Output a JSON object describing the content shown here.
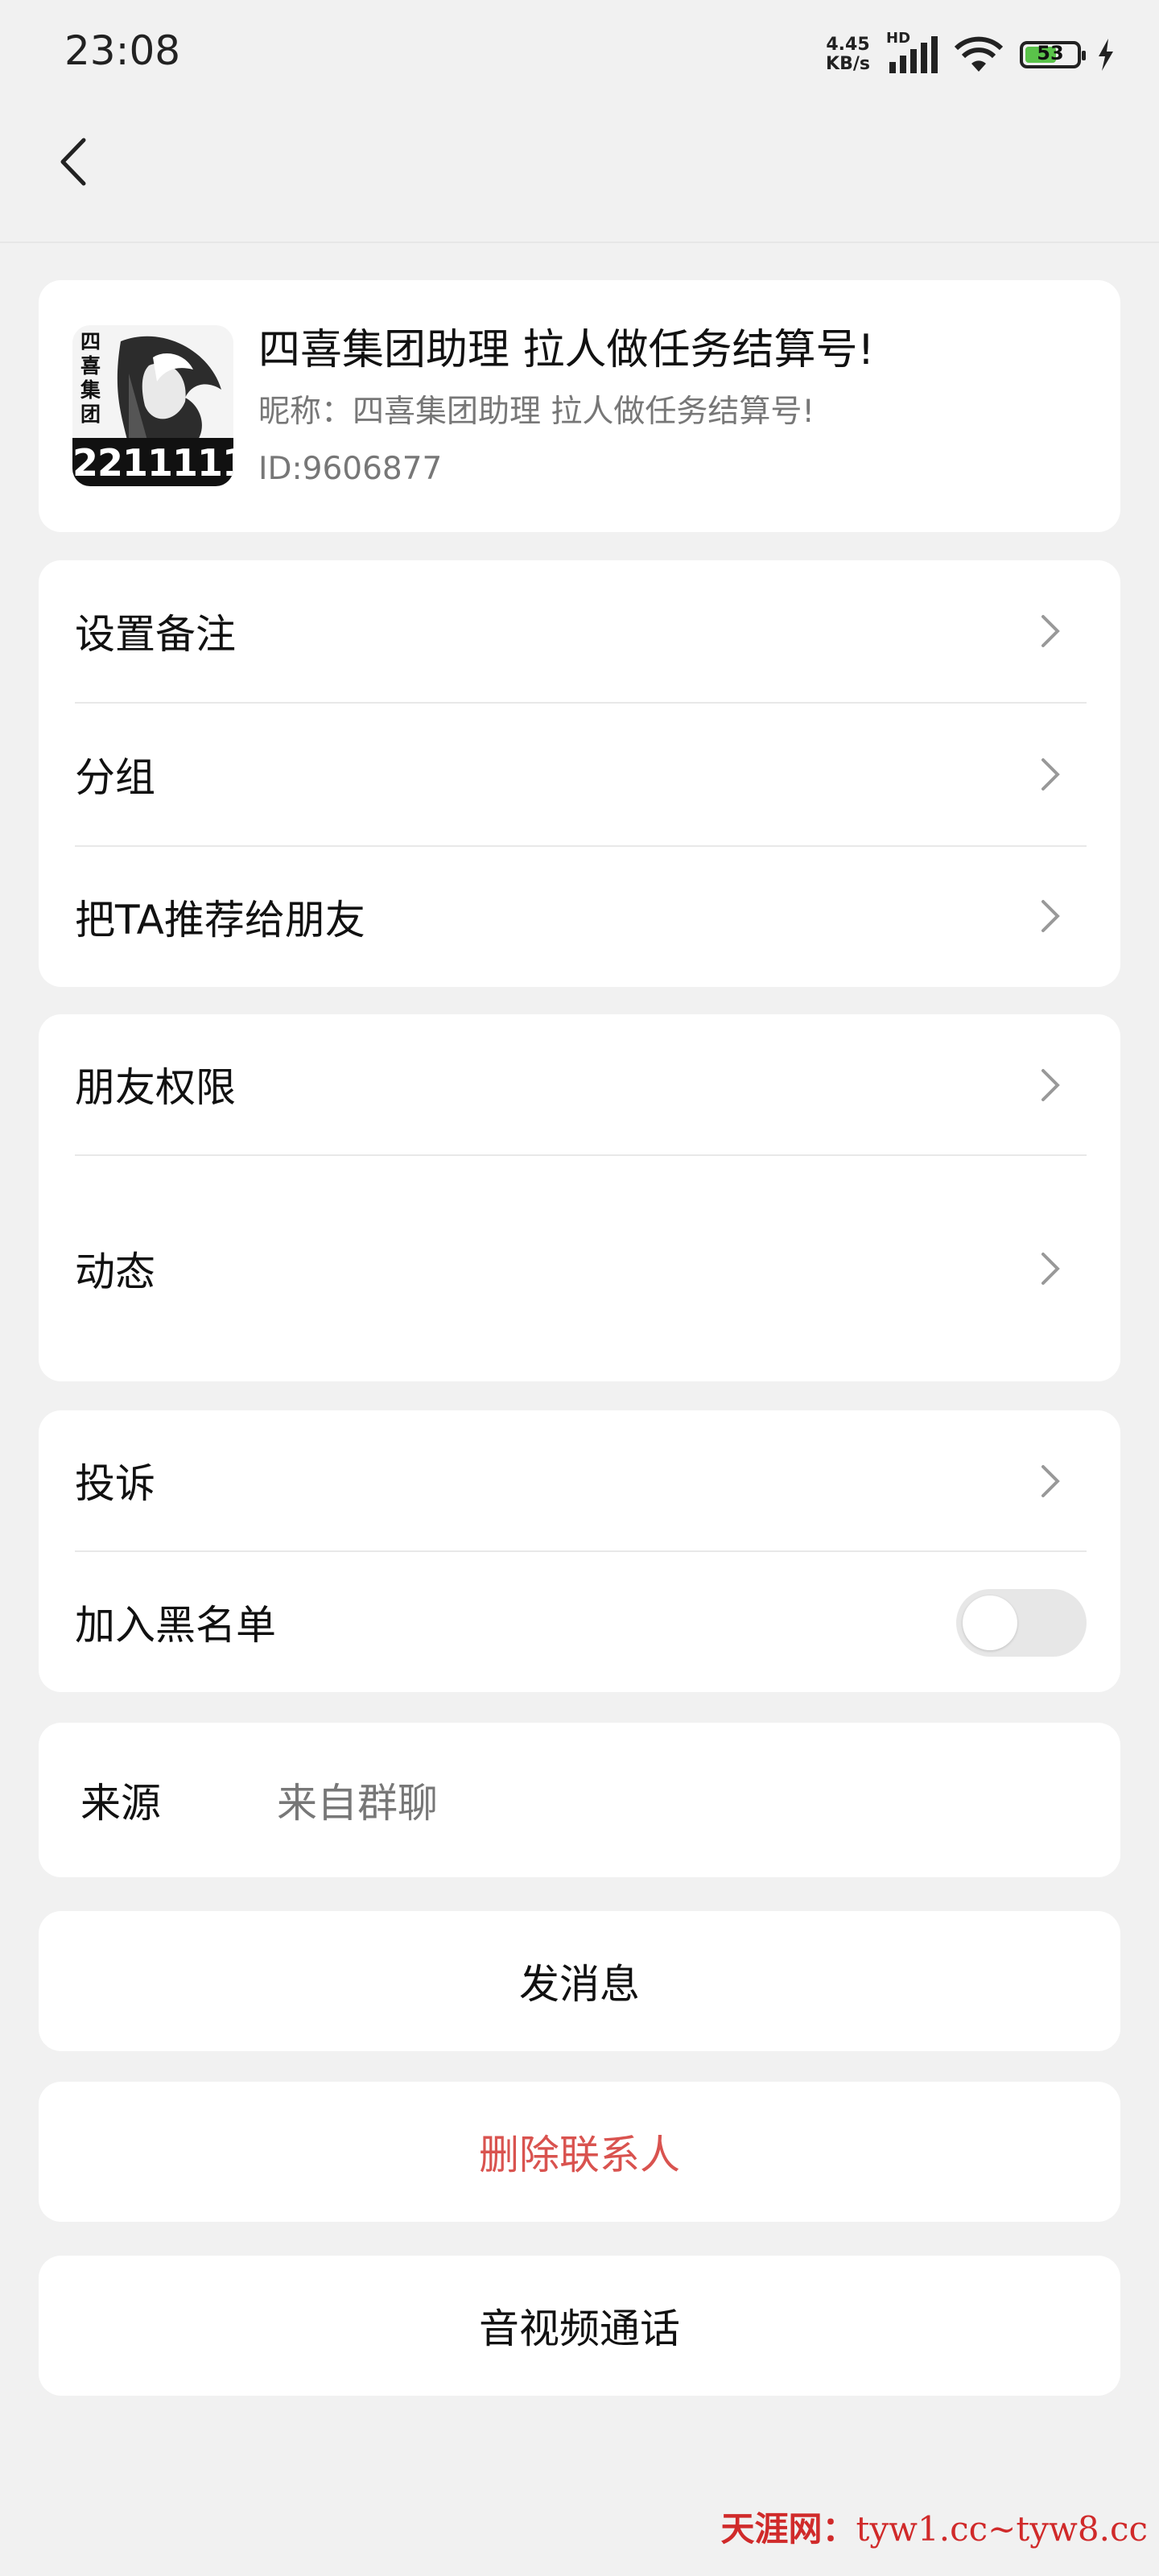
{
  "status_bar": {
    "time": "23:08",
    "net_speed_value": "4.45",
    "net_speed_unit": "KB/s",
    "network_type": "HD",
    "battery_level": "53",
    "icons": [
      "signal-icon",
      "wifi-icon",
      "battery-icon",
      "charging-icon"
    ]
  },
  "header": {
    "back_icon": "back-chevron-icon"
  },
  "profile": {
    "name": "四喜集团助理 拉人做任务结算号!",
    "nickname": "昵称：四喜集团助理 拉人做任务结算号!",
    "id": "ID:9606877",
    "avatar_text_top": "四喜集团",
    "avatar_number": "2211111"
  },
  "settings_group_1": [
    {
      "label": "设置备注"
    },
    {
      "label": "分组"
    },
    {
      "label": "把TA推荐给朋友"
    }
  ],
  "settings_group_2": [
    {
      "label": "朋友权限"
    },
    {
      "label": "动态"
    }
  ],
  "settings_group_3": {
    "complaint_label": "投诉",
    "blacklist_label": "加入黑名单",
    "blacklist_enabled": false
  },
  "source": {
    "label": "来源",
    "value": "来自群聊"
  },
  "actions": {
    "send_message": "发消息",
    "delete_contact": "删除联系人",
    "av_call": "音视频通话"
  },
  "colors": {
    "background": "#f1f1f1",
    "card": "#ffffff",
    "danger": "#d9534f",
    "muted": "#777777"
  },
  "watermark": {
    "brand": "天涯网：",
    "url": "tyw1.cc~tyw8.cc"
  }
}
